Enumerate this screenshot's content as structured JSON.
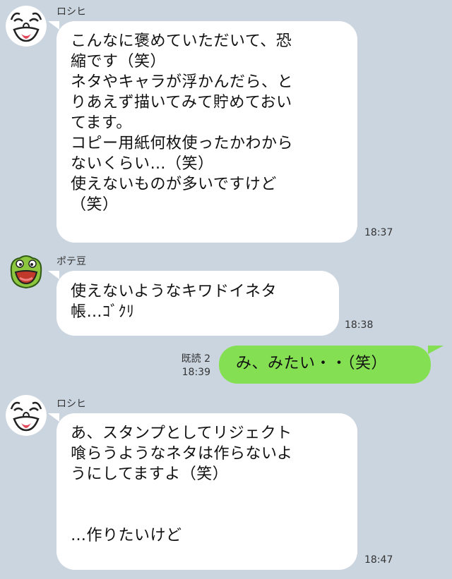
{
  "messages": [
    {
      "sender": "ロシヒ",
      "avatar": "old-man-face-icon",
      "lines": [
        "こんなに褒めていただいて、恐",
        "縮です（笑）",
        "ネタやキャラが浮かんだら、と",
        "りあえず描いてみて貯めておい",
        "てます。",
        "コピー用紙何枚使ったかわから",
        "ないくらい…（笑）",
        "使えないものが多いですけど",
        "（笑）"
      ],
      "time": "18:37"
    },
    {
      "sender": "ポテ豆",
      "avatar": "green-frog-icon",
      "lines": [
        "使えないようなキワドイネタ",
        "帳…ｺﾞｸﾘ"
      ],
      "time": "18:38"
    },
    {
      "outgoing": true,
      "read_label": "既読 2",
      "time": "18:39",
      "lines": [
        "み、みたい・・（笑）"
      ]
    },
    {
      "sender": "ロシヒ",
      "avatar": "old-man-face-icon",
      "lines": [
        "あ、スタンプとしてリジェクト",
        "喰らうようなネタは作らないよ",
        "うにしてますよ（笑）",
        "",
        "",
        "…作りたいけど"
      ],
      "time": "18:47"
    }
  ],
  "colors": {
    "background": "#cbd5e0",
    "incoming_bubble": "#ffffff",
    "outgoing_bubble": "#84e052"
  }
}
